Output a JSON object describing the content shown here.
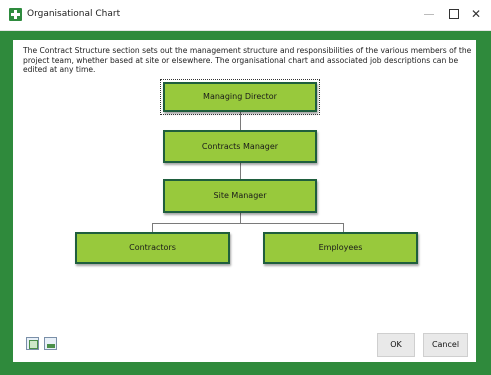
{
  "window": {
    "title": "Organisational Chart"
  },
  "description": "The Contract Structure section sets out the management structure and responsibilities of the various members of the project team, whether based at site or elsewhere. The organisational chart and associated job descriptions can be edited at any time.",
  "org_chart": {
    "nodes": [
      {
        "id": "md",
        "label": "Managing Director",
        "selected": true
      },
      {
        "id": "cm",
        "label": "Contracts Manager"
      },
      {
        "id": "sm",
        "label": "Site Manager"
      },
      {
        "id": "con",
        "label": "Contractors"
      },
      {
        "id": "emp",
        "label": "Employees"
      }
    ]
  },
  "footer": {
    "icons": [
      "refresh-chart-icon",
      "edit-chart-icon"
    ],
    "ok_label": "OK",
    "cancel_label": "Cancel"
  },
  "colors": {
    "frame": "#2f8a3c",
    "node_fill": "#98c93c",
    "node_border": "#1f5e3d"
  }
}
